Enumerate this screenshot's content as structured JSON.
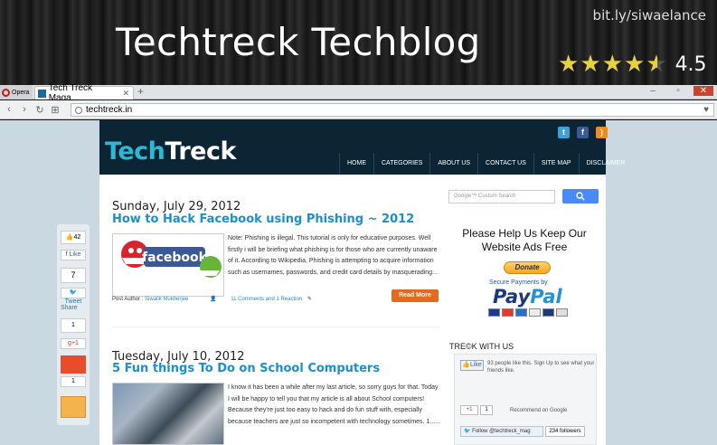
{
  "banner": {
    "title": "Techtreck Techblog",
    "link": "bit.ly/siwaelance",
    "rating_value": 4.5,
    "rating_label": "4.5",
    "star_color": "#e6d23a"
  },
  "browser": {
    "menu_label": "Opera",
    "tab_title": "Tech Treck Maga...",
    "url": "techtreck.in",
    "icons": [
      "back-icon",
      "forward-icon",
      "reload-icon",
      "speeddial-icon",
      "globe-icon",
      "heart-icon",
      "close-icon",
      "plus-icon"
    ]
  },
  "site": {
    "logo_part1": "Tech",
    "logo_part2": "Treck",
    "accent_color": "#2fb7d4",
    "header_color": "#0b2535",
    "nav": [
      "HOME",
      "CATEGORIES",
      "ABOUT US",
      "CONTACT US",
      "SITE MAP",
      "DISCLAIMER"
    ],
    "social_icons": [
      "twitter-icon",
      "facebook-icon",
      "rss-icon"
    ]
  },
  "share_bar": {
    "fb_count": "42",
    "fb_like": "Like",
    "tweet_count": "7",
    "tweet_label": "Tweet",
    "share_label": "Share",
    "gplus_count": "1",
    "gplus_label": "+1",
    "stumble_count": "1"
  },
  "posts": [
    {
      "date": "Sunday, July 29, 2012",
      "title": "How to Hack Facebook using Phishing ~ 2012",
      "image_text": "facebook",
      "excerpt": "Note: Phishing is illegal. This tutorial is only for educative purposes. Well firstly i will be briefing what phishing is for those who are currently unaware of it. According to Wikipedia, Phishing is attempting to acquire information such as usernames, passwords, and credit card details by masquerading...",
      "author_label": "Post Author :",
      "author": "Siwalik Mukherjee",
      "comments": "11 Comments and 1 Reaction",
      "read_more": "Read More"
    },
    {
      "date": "Tuesday, July 10, 2012",
      "title": "5 Fun things To Do on School Computers",
      "excerpt": "I know it has been a while after my last article, so sorry guys for that. Today I will be happy to tell you that my article is all about School computers! Because they're just too easy to hack and do fun stuff with, especially because teachers are just so incompetent with technology sometimes. 1......"
    }
  ],
  "sidebar": {
    "search_placeholder": "Google™ Custom Search",
    "help_title": "Please Help Us Keep Our Website Ads Free",
    "donate": "Donate",
    "secure_label": "Secure Payments by",
    "paypal_pay": "Pay",
    "paypal_pal": "Pal",
    "trek_title": "TRE©K WITH US",
    "fb_like": "Like",
    "fb_text": "93 people like this. Sign Up to see what your friends like.",
    "gplus_label": "+1",
    "gplus_count": "1",
    "gplus_text": "Recommend on Google",
    "follow_label": "Follow @techtreck_mag",
    "followers": "234 followers"
  }
}
